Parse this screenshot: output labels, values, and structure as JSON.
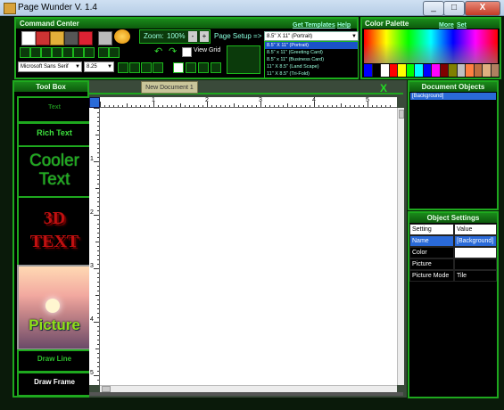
{
  "window": {
    "title": "Page Wunder V. 1.4",
    "min": "_",
    "max": "□",
    "close": "X"
  },
  "command_center": {
    "title": "Command Center",
    "links": [
      "Get Templates",
      "Help"
    ],
    "zoom_label": "Zoom:",
    "zoom_value": "100%",
    "zoom_minus": "-",
    "zoom_plus": "+",
    "page_setup_label": "Page Setup =>",
    "view_grid_label": "View Grid",
    "view_grid_checked": false,
    "font_value": "Microsoft Sans Serif",
    "font_size_value": "8.25",
    "page_setup_selected": "8.5\" X 11\" (Portrait)",
    "page_setup_options": [
      "8.5\" X 11\" (Portrait)",
      "8.5\" x 11\" (Greeting Card)",
      "8.5\" x 11\" (Business Card)",
      "11\" X 8.5\" (Land Scape)",
      "11\" X 8.5\" (Tri-Fold)"
    ],
    "fill_color": "#0b3a0b"
  },
  "color_palette": {
    "title": "Color Palette",
    "links": [
      "More",
      "Set Transparent"
    ],
    "swatches": [
      "#0000ff",
      "#000000",
      "#ffffff",
      "#ff0000",
      "#ffff00",
      "#00ff00",
      "#00ffff",
      "#0000ff",
      "#ff00ff",
      "#800000",
      "#808000",
      "#c0c0c0",
      "#ff8040",
      "#c07040",
      "#e0b080",
      "#b08060"
    ]
  },
  "toolbox": {
    "title": "Tool Box",
    "items": [
      "Text",
      "Rich Text",
      "Cooler Text",
      "3D TEXT",
      "Picture",
      "Draw Line",
      "Draw Frame"
    ]
  },
  "document": {
    "tab_label": "New Document 1",
    "close_label": "X"
  },
  "ruler": {
    "h_numbers": [
      "1",
      "2",
      "3",
      "4",
      "5"
    ],
    "v_numbers": [
      "1",
      "2",
      "3",
      "4",
      "5"
    ]
  },
  "document_objects": {
    "title": "Document Objects",
    "items": [
      "[Background]"
    ]
  },
  "object_settings": {
    "title": "Object Settings",
    "headers": [
      "Setting",
      "Value"
    ],
    "rows": [
      {
        "setting": "Name",
        "value": "[Background]"
      },
      {
        "setting": "Color",
        "value": ""
      },
      {
        "setting": "Picture",
        "value": ""
      },
      {
        "setting": "Picture Mode",
        "value": "Tile"
      }
    ]
  }
}
